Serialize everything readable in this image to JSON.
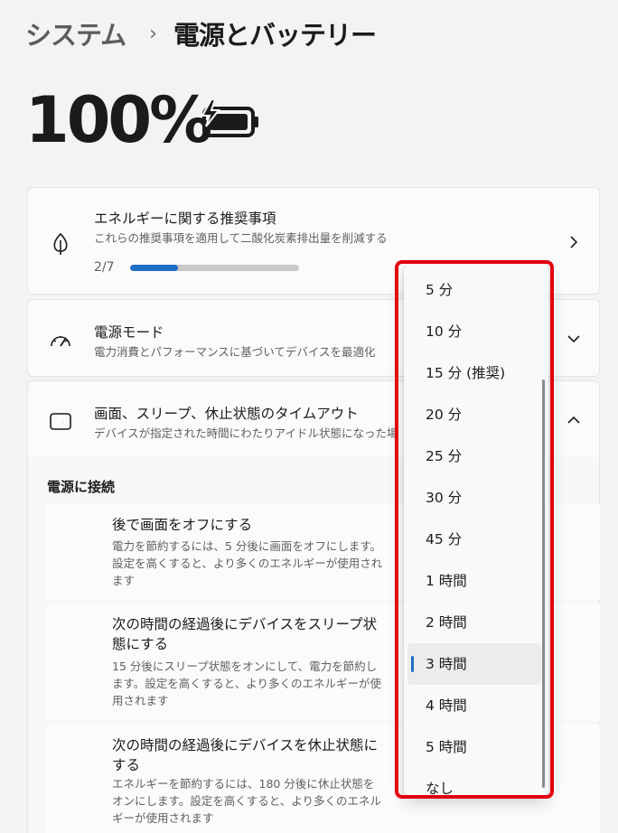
{
  "breadcrumb": {
    "parent": "システム",
    "separator": "›",
    "current": "電源とバッテリー"
  },
  "battery": {
    "percent_label": "100%",
    "icon": "battery-charging-icon"
  },
  "energy_card": {
    "title": "エネルギーに関する推奨事項",
    "description": "これらの推奨事項を適用して二酸化炭素排出量を削減する",
    "progress_label": "2/7",
    "progress_fraction": 0.2857,
    "icon": "leaf-icon"
  },
  "power_mode_card": {
    "title": "電源モード",
    "description": "電力消費とパフォーマンスに基づいてデバイスを最適化",
    "icon": "gauge-icon"
  },
  "timeout_card": {
    "title": "画面、スリープ、休止状態のタイムアウト",
    "description": "デバイスが指定された時間にわたりアイドル状態になった場",
    "icon": "screen-sleep-icon"
  },
  "plugged_in_section": {
    "heading": "電源に接続",
    "settings": [
      {
        "title": "後で画面をオフにする",
        "description": "電力を節約するには、5 分後に画面をオフにします。設定を高くすると、より多くのエネルギーが使用されます"
      },
      {
        "title": "次の時間の経過後にデバイスをスリープ状態にする",
        "description": "15 分後にスリープ状態をオンにして、電力を節約します。設定を高くすると、より多くのエネルギーが使用されます"
      },
      {
        "title": "次の時間の経過後にデバイスを休止状態にする",
        "description": "エネルギーを節約するには、180 分後に休止状態をオンにします。設定を高くすると、より多くのエネルギーが使用されます"
      }
    ]
  },
  "dropdown": {
    "options": [
      "5 分",
      "10 分",
      "15 分 (推奨)",
      "20 分",
      "25 分",
      "30 分",
      "45 分",
      "1 時間",
      "2 時間",
      "3 時間",
      "4 時間",
      "5 時間",
      "なし"
    ],
    "selected_index": 9
  },
  "colors": {
    "accent": "#1f6fc4",
    "highlight": "#e3000f"
  }
}
